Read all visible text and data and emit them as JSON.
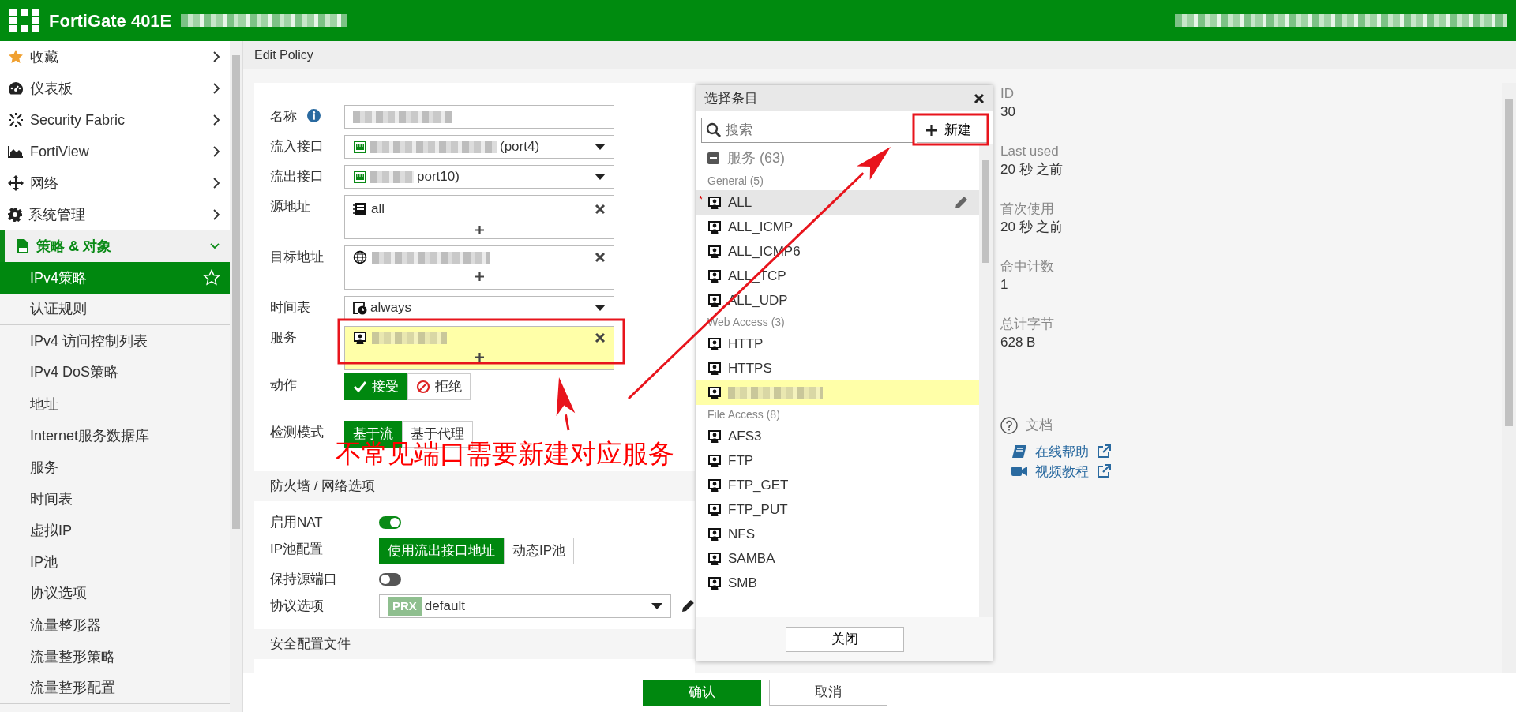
{
  "header": {
    "title": "FortiGate 401E",
    "hostname_redacted": true,
    "status_redacted": true
  },
  "sidebar": {
    "items": [
      {
        "label": "收藏",
        "expanded": false
      },
      {
        "label": "仪表板",
        "expanded": false
      },
      {
        "label": "Security Fabric",
        "expanded": false
      },
      {
        "label": "FortiView",
        "expanded": false
      },
      {
        "label": "网络",
        "expanded": false
      },
      {
        "label": "系统管理",
        "expanded": false
      },
      {
        "label": "策略 & 对象",
        "expanded": true,
        "children": [
          {
            "label": "IPv4策略",
            "selected": true,
            "divider_after": false
          },
          {
            "label": "认证规则",
            "selected": false,
            "divider_after": true
          },
          {
            "label": "IPv4 访问控制列表",
            "selected": false,
            "divider_after": false
          },
          {
            "label": "IPv4 DoS策略",
            "selected": false,
            "divider_after": true
          },
          {
            "label": "地址",
            "selected": false,
            "divider_after": false
          },
          {
            "label": "Internet服务数据库",
            "selected": false,
            "divider_after": false
          },
          {
            "label": "服务",
            "selected": false,
            "divider_after": false
          },
          {
            "label": "时间表",
            "selected": false,
            "divider_after": false
          },
          {
            "label": "虚拟IP",
            "selected": false,
            "divider_after": false
          },
          {
            "label": "IP池",
            "selected": false,
            "divider_after": false
          },
          {
            "label": "协议选项",
            "selected": false,
            "divider_after": true
          },
          {
            "label": "流量整形器",
            "selected": false,
            "divider_after": false
          },
          {
            "label": "流量整形策略",
            "selected": false,
            "divider_after": false
          },
          {
            "label": "流量整形配置",
            "selected": false,
            "divider_after": true
          }
        ]
      }
    ]
  },
  "page_title": "Edit Policy",
  "form": {
    "fields": [
      {
        "kind": "text",
        "label": "名称",
        "info": true,
        "redacted": true
      },
      {
        "kind": "select",
        "label": "流入接口",
        "redacted": true,
        "value": "(port4)"
      },
      {
        "kind": "select",
        "label": "流出接口",
        "redacted": true,
        "value": "port10)"
      },
      {
        "kind": "multi",
        "label": "源地址",
        "value": "all"
      },
      {
        "kind": "multi",
        "label": "目标地址",
        "redacted": true
      },
      {
        "kind": "select",
        "label": "时间表",
        "value": "always"
      },
      {
        "kind": "multi",
        "label": "服务",
        "redacted": true,
        "highlighted": true
      },
      {
        "kind": "choice",
        "label": "动作",
        "options": [
          {
            "label": "接受",
            "kind": "accept",
            "selected": true
          },
          {
            "label": "拒绝",
            "kind": "deny",
            "selected": false
          }
        ]
      },
      {
        "kind": "choice",
        "label": "检测模式",
        "options": [
          {
            "label": "基于流",
            "selected": true
          },
          {
            "label": "基于代理",
            "selected": false
          }
        ]
      }
    ],
    "sections": [
      {
        "title": "防火墙 / 网络选项",
        "fields": [
          {
            "kind": "switch",
            "label": "启用NAT",
            "on": true
          },
          {
            "kind": "choice",
            "label": "IP池配置",
            "options": [
              {
                "label": "使用流出接口地址",
                "selected": true
              },
              {
                "label": "动态IP池",
                "selected": false
              }
            ]
          },
          {
            "kind": "switch",
            "label": "保持源端口",
            "on": false
          },
          {
            "kind": "select",
            "label": "协议选项",
            "tag": "PRX",
            "value": "default",
            "editable": true
          }
        ]
      },
      {
        "title": "安全配置文件"
      }
    ]
  },
  "dialog": {
    "title": "选择条目",
    "search": {
      "placeholder": "搜索"
    },
    "new_button": "新建",
    "category": {
      "label": "服务 (63)",
      "expanded": true
    },
    "groups": [
      {
        "label": "General (5)",
        "items": [
          {
            "label": "ALL",
            "flag": "*",
            "hovered": true,
            "selected": false
          },
          {
            "label": "ALL_ICMP",
            "hovered": false,
            "selected": false
          },
          {
            "label": "ALL_ICMP6",
            "hovered": false,
            "selected": false
          },
          {
            "label": "ALL_TCP",
            "hovered": false,
            "selected": false
          },
          {
            "label": "ALL_UDP",
            "hovered": false,
            "selected": false
          }
        ]
      },
      {
        "label": "Web Access (3)",
        "items": [
          {
            "label": "HTTP",
            "hovered": false,
            "selected": false
          },
          {
            "label": "HTTPS",
            "hovered": false,
            "selected": false
          },
          {
            "redacted": true,
            "hovered": false,
            "selected": true
          }
        ]
      },
      {
        "label": "File Access (8)",
        "items": [
          {
            "label": "AFS3",
            "hovered": false,
            "selected": false
          },
          {
            "label": "FTP",
            "hovered": false,
            "selected": false
          },
          {
            "label": "FTP_GET",
            "hovered": false,
            "selected": false
          },
          {
            "label": "FTP_PUT",
            "hovered": false,
            "selected": false
          },
          {
            "label": "NFS",
            "hovered": false,
            "selected": false
          },
          {
            "label": "SAMBA",
            "hovered": false,
            "selected": false
          },
          {
            "label": "SMB",
            "hovered": false,
            "selected": false
          }
        ]
      }
    ],
    "close_button": "关闭"
  },
  "stats": [
    {
      "label": "ID",
      "value": "30"
    },
    {
      "label": "Last used",
      "value": "20 秒 之前"
    },
    {
      "label": "首次使用",
      "value": "20 秒 之前"
    },
    {
      "label": "命中计数",
      "value": "1"
    },
    {
      "label": "总计字节",
      "value": "628 B"
    }
  ],
  "docs": {
    "title": "文档",
    "links": [
      {
        "label": "在线帮助"
      },
      {
        "label": "视频教程"
      }
    ]
  },
  "footer": {
    "buttons": [
      {
        "label": "确认",
        "primary": true
      },
      {
        "label": "取消",
        "primary": false
      }
    ]
  },
  "annotation": {
    "text": "不常见端口需要新建对应服务"
  }
}
